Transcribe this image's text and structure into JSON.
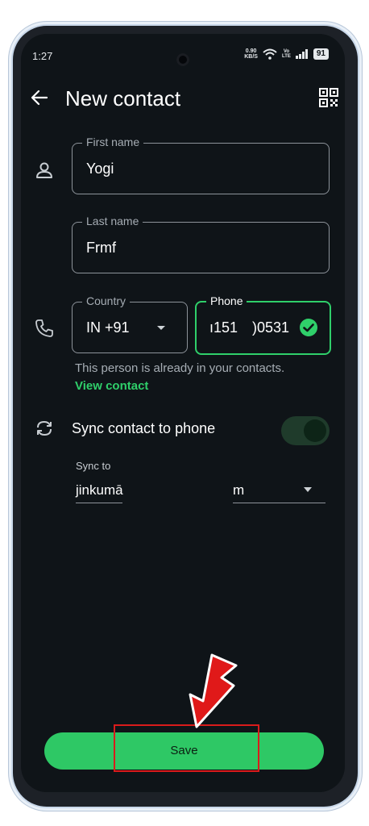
{
  "status_bar": {
    "time": "1:27",
    "net_speed_value": "0.90",
    "net_speed_unit": "KB/S",
    "volte_top": "Vo",
    "volte_bottom": "LTE",
    "battery": "91"
  },
  "app_bar": {
    "title": "New contact",
    "back_icon": "arrow-left-icon",
    "qr_icon": "qr-code-icon"
  },
  "form": {
    "first_name": {
      "label": "First name",
      "value": "Yogi"
    },
    "last_name": {
      "label": "Last name",
      "value": "Frmf"
    },
    "country": {
      "label": "Country",
      "value": "IN +91"
    },
    "phone": {
      "label": "Phone",
      "value": "ı151 )0531"
    },
    "duplicate_notice": "This person is already in your contacts.",
    "view_contact_link": "View contact"
  },
  "sync": {
    "label": "Sync contact to phone",
    "toggle_on": true,
    "sync_to_label": "Sync to",
    "account_part_1": "jinkumā",
    "account_part_2": "m"
  },
  "actions": {
    "save_label": "Save"
  },
  "colors": {
    "accent": "#2fcf6a",
    "background": "#0f1418",
    "annotation": "#d91b1b"
  }
}
